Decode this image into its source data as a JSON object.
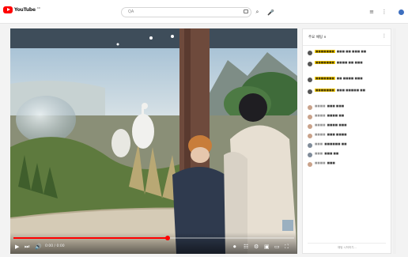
{
  "header": {
    "logo_text": "YouTube",
    "logo_sup": "KR",
    "search_value": "QA",
    "icons": [
      "keyboard-icon",
      "search-icon",
      "mic-icon",
      "menu-icon",
      "more-icon",
      "avatar"
    ]
  },
  "player": {
    "time_text": "0:00 / 0:00",
    "progress_fraction": 0.55,
    "controls": [
      "play-icon",
      "next-icon",
      "volume-icon",
      "autoplay-icon",
      "subtitles-icon",
      "settings-icon",
      "miniplayer-icon",
      "theater-icon",
      "fullscreen-icon"
    ]
  },
  "chat": {
    "title": "주요 채팅 ∨",
    "input_placeholder": "채팅 시작하기...",
    "messages": [
      {
        "author": "■■■■■■■",
        "text": "■■■ ■■ ■■■ ■■",
        "highlight": true,
        "avatar_color": "#555555"
      },
      {
        "author": "■■■■■■■",
        "text": "■■■■ ■■ ■■■",
        "highlight": true,
        "avatar_color": "#555555"
      },
      {
        "author": "■■■■■■■",
        "text": "■■ ■■■■ ■■■",
        "highlight": true,
        "avatar_color": "#555555"
      },
      {
        "author": "■■■■■■■",
        "text": "■■■ ■■■■■ ■■",
        "highlight": true,
        "avatar_color": "#555555"
      },
      {
        "author": "■■■■",
        "text": "■■■ ■■■",
        "highlight": false,
        "avatar_color": "#c9a28a"
      },
      {
        "author": "■■■■",
        "text": "■■■■ ■■",
        "highlight": false,
        "avatar_color": "#c9a28a"
      },
      {
        "author": "■■■■",
        "text": "■■■■ ■■■",
        "highlight": false,
        "avatar_color": "#c9a28a"
      },
      {
        "author": "■■■■",
        "text": "■■■ ■■■■",
        "highlight": false,
        "avatar_color": "#c9a28a"
      },
      {
        "author": "■■■",
        "text": "■■■■■■ ■■",
        "highlight": false,
        "avatar_color": "#7f8b99"
      },
      {
        "author": "■■■",
        "text": "■■■ ■■",
        "highlight": false,
        "avatar_color": "#7f8b99"
      },
      {
        "author": "■■■■",
        "text": "■■■",
        "highlight": false,
        "avatar_color": "#c9a28a"
      }
    ]
  },
  "colors": {
    "brand": "#ff0000",
    "highlight": "#ffd600"
  }
}
